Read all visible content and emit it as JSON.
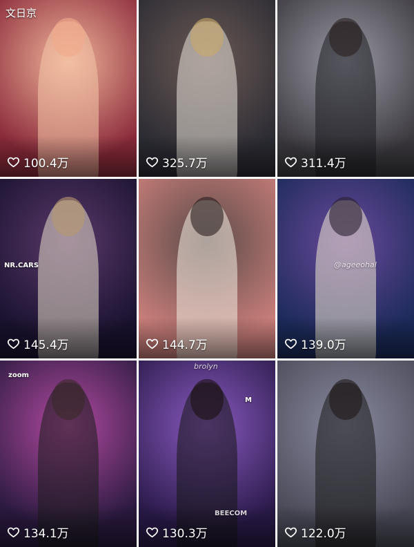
{
  "watermark": "文日京",
  "heart_icon": "heart-outline-icon",
  "tiles": [
    {
      "likes": "100.4万",
      "colors": [
        "#8a2a3a",
        "#f0b49a"
      ],
      "figure": "#f4c7a8",
      "hair": "#f2a98a"
    },
    {
      "likes": "325.7万",
      "colors": [
        "#2b2b33",
        "#6b5a55"
      ],
      "figure": "#e8e2d8",
      "hair": "#c9a96a"
    },
    {
      "likes": "311.4万",
      "colors": [
        "#3c3a3f",
        "#9a9aa6"
      ],
      "figure": "#1e1e22",
      "hair": "#2a2020"
    },
    {
      "likes": "145.4万",
      "colors": [
        "#1a1230",
        "#5a3a6a"
      ],
      "figure": "#e6ddc8",
      "hair": "#b89a70"
    },
    {
      "likes": "144.7万",
      "colors": [
        "#c97e7a",
        "#5a4a48"
      ],
      "figure": "#f2ece2",
      "hair": "#2a2020"
    },
    {
      "likes": "139.0万",
      "colors": [
        "#1b2a5a",
        "#6a4a9a"
      ],
      "figure": "#efe6d0",
      "hair": "#2a2030"
    },
    {
      "likes": "134.1万",
      "colors": [
        "#2a1a40",
        "#b24aa0"
      ],
      "figure": "#1c1c1c",
      "hair": "#3a2a2a"
    },
    {
      "likes": "130.3万",
      "colors": [
        "#2a1a4a",
        "#8a5ac0"
      ],
      "figure": "#151515",
      "hair": "#1a1010"
    },
    {
      "likes": "122.0万",
      "colors": [
        "#4a4a58",
        "#8a8aa0"
      ],
      "figure": "#1a1a1a",
      "hair": "#1e1818"
    }
  ],
  "stage_texts": {
    "tile4": "NR.CARS",
    "tile6": "@ageeohal",
    "tile7": "zoom",
    "tile8_brand": "brolyn",
    "tile8_mic": "M",
    "tile8_text": "BEECOM"
  }
}
